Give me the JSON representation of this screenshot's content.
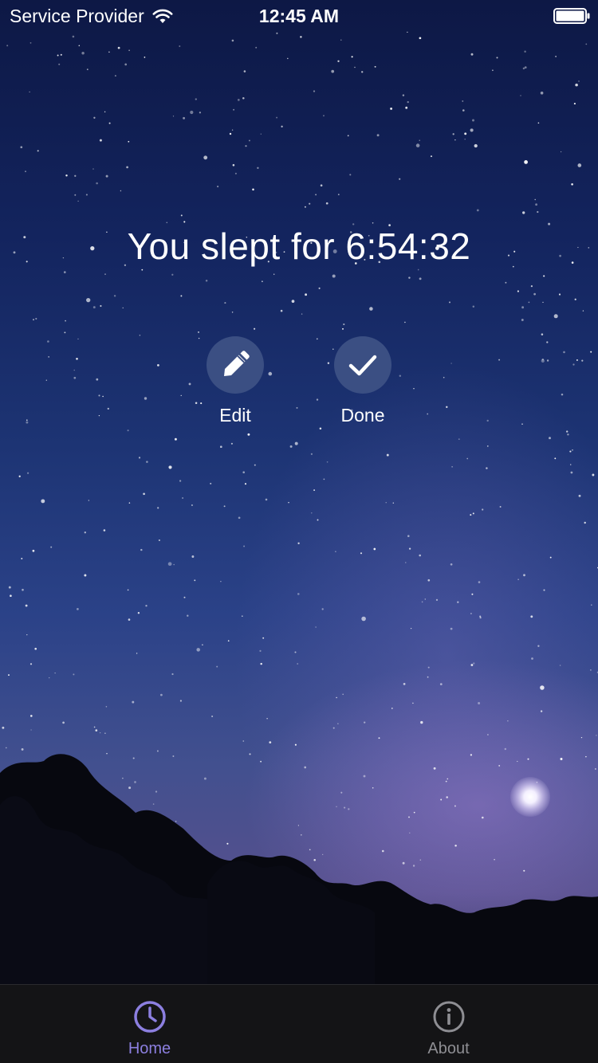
{
  "status_bar": {
    "carrier": "Service Provider",
    "time": "12:45 AM",
    "wifi_icon": "wifi-icon",
    "battery_icon": "battery-icon"
  },
  "main": {
    "sleep_message": "You slept for 6:54:32",
    "actions": [
      {
        "label": "Edit",
        "icon": "pencil-icon"
      },
      {
        "label": "Done",
        "icon": "checkmark-icon"
      }
    ]
  },
  "tab_bar": {
    "tabs": [
      {
        "label": "Home",
        "icon": "clock-icon",
        "selected": true
      },
      {
        "label": "About",
        "icon": "info-icon",
        "selected": false
      }
    ]
  },
  "colors": {
    "button_fill": "#3b4f83",
    "tab_active": "#8c7fe0",
    "tab_inactive": "#8e8e93",
    "tab_bar_bg": "#141416"
  }
}
